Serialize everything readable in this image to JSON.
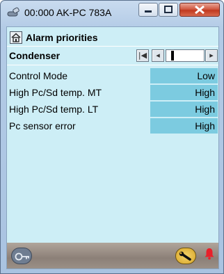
{
  "window": {
    "title": "00:000 AK-PC 783A",
    "controls": [
      "minimize",
      "maximize",
      "close"
    ]
  },
  "header": {
    "icon": "home-icon",
    "title": "Alarm priorities"
  },
  "section": {
    "title": "Condenser",
    "nav": {
      "first_icon": "first-page-icon",
      "prev_icon": "prev-page-icon",
      "next_icon": "next-page-icon",
      "scroll_position": 0.1
    }
  },
  "rows": [
    {
      "label": "Control Mode",
      "value": "Low"
    },
    {
      "label": "High Pc/Sd temp. MT",
      "value": "High"
    },
    {
      "label": "High Pc/Sd temp. LT",
      "value": "High"
    },
    {
      "label": "Pc sensor error",
      "value": "High"
    }
  ],
  "bottom_bar": {
    "left_icon": "key-icon",
    "right_icon": "wrench-icon",
    "alarm_icon": "alarm-bell-icon"
  },
  "colors": {
    "client_bg": "#cdeef6",
    "value_bg": "#7ccbe0",
    "alarm": "#e8202a"
  }
}
